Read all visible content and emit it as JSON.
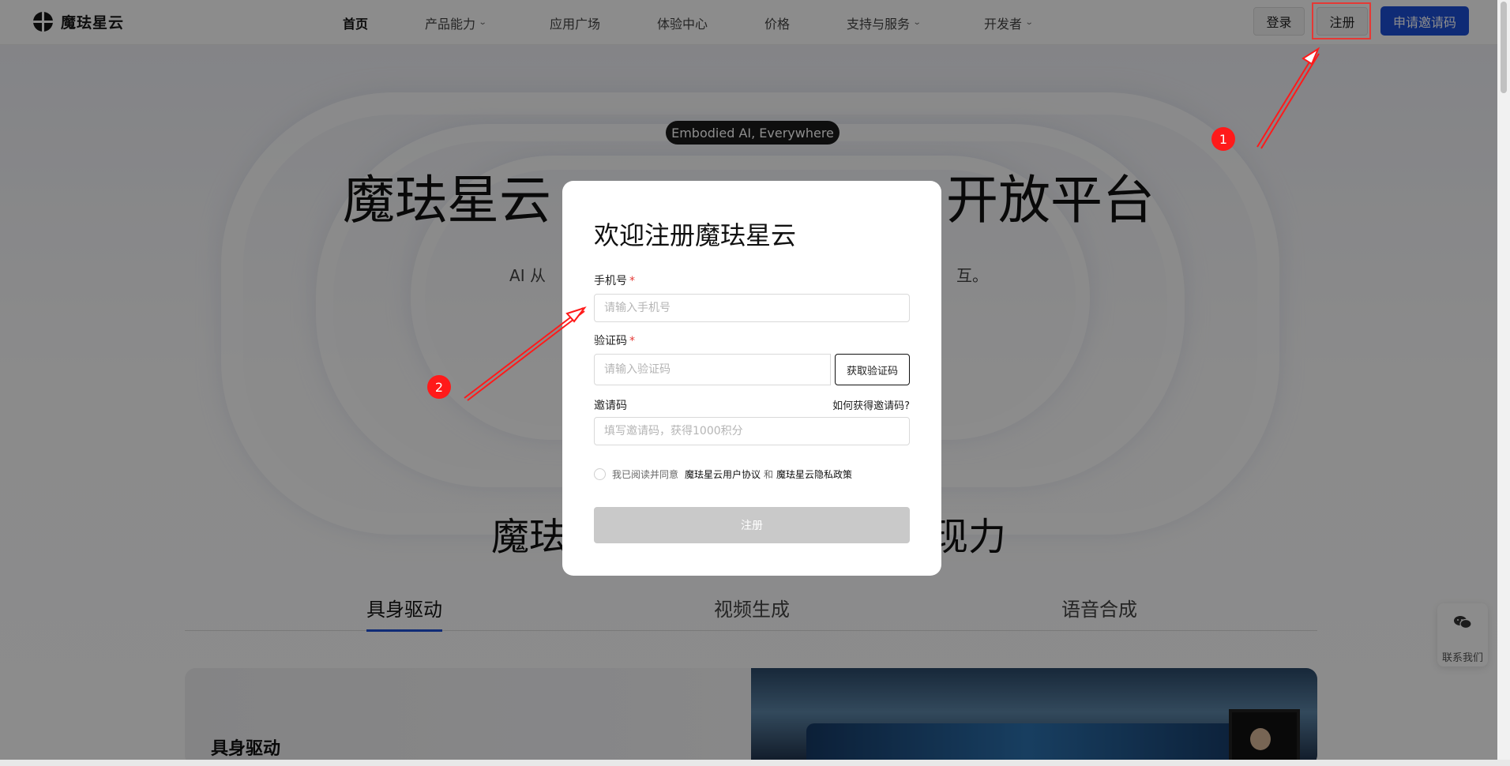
{
  "header": {
    "logo_text": "魔珐星云",
    "nav": [
      {
        "label": "首页",
        "active": true,
        "has_dropdown": false
      },
      {
        "label": "产品能力",
        "active": false,
        "has_dropdown": true
      },
      {
        "label": "应用广场",
        "active": false,
        "has_dropdown": false
      },
      {
        "label": "体验中心",
        "active": false,
        "has_dropdown": false
      },
      {
        "label": "价格",
        "active": false,
        "has_dropdown": false
      },
      {
        "label": "支持与服务",
        "active": false,
        "has_dropdown": true
      },
      {
        "label": "开发者",
        "active": false,
        "has_dropdown": true
      }
    ],
    "login_label": "登录",
    "register_label": "注册",
    "invite_label": "申请邀请码"
  },
  "hero": {
    "pill": "Embodied AI, Everywhere",
    "title_left": "魔珐星云",
    "title_right": "开放平台",
    "subtitle_left": "AI 从",
    "subtitle_right": "互。"
  },
  "section": {
    "title_left": "魔珐",
    "title_right": "现力",
    "tabs": [
      {
        "label": "具身驱动",
        "active": true
      },
      {
        "label": "视频生成",
        "active": false
      },
      {
        "label": "语音合成",
        "active": false
      }
    ],
    "card_title": "具身驱动"
  },
  "contact": {
    "label": "联系我们",
    "icon": "wechat-icon"
  },
  "modal": {
    "title": "欢迎注册魔珐星云",
    "phone_label": "手机号",
    "phone_placeholder": "请输入手机号",
    "code_label": "验证码",
    "code_placeholder": "请输入验证码",
    "get_code_label": "获取验证码",
    "invite_label": "邀请码",
    "invite_help": "如何获得邀请码?",
    "invite_placeholder": "填写邀请码，获得1000积分",
    "agree_prefix": "我已阅读并同意",
    "agree_terms": "魔珐星云用户协议",
    "agree_and": "和",
    "agree_privacy": "魔珐星云隐私政策",
    "submit_label": "注册",
    "required_mark": "*"
  },
  "annotations": {
    "badge_1": "1",
    "badge_2": "2",
    "color": "#ff1a1a"
  },
  "colors": {
    "primary": "#1d4fd8",
    "overlay": "rgba(0,0,0,0.45)",
    "annotation_red": "#e53935"
  }
}
